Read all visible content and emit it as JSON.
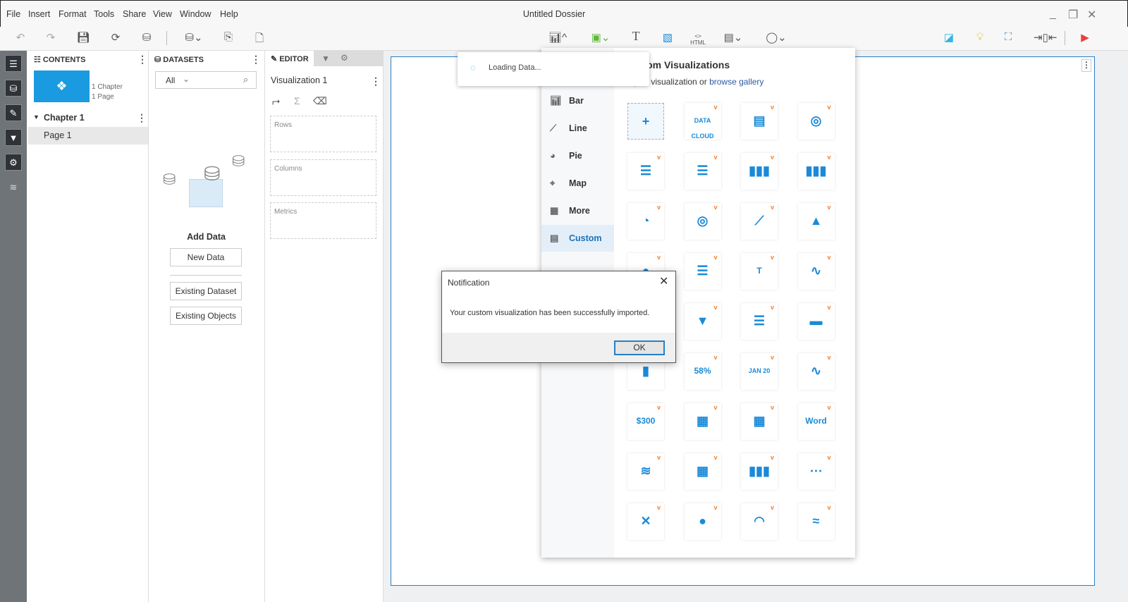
{
  "window": {
    "title": "Untitled Dossier"
  },
  "menu": [
    "File",
    "Insert",
    "Format",
    "Tools",
    "Share",
    "View",
    "Window",
    "Help"
  ],
  "contents": {
    "header": "CONTENTS",
    "summary_chapters": "1 Chapter",
    "summary_pages": "1 Page",
    "chapter": "Chapter 1",
    "page": "Page 1"
  },
  "datasets": {
    "header": "DATASETS",
    "filter": "All",
    "add_data": "Add Data",
    "new_data": "New Data",
    "existing_dataset": "Existing Dataset",
    "existing_objects": "Existing Objects"
  },
  "editor": {
    "tab": "EDITOR",
    "viz_name": "Visualization 1",
    "rows": "Rows",
    "columns": "Columns",
    "metrics": "Metrics"
  },
  "gallery": {
    "title": "Custom Visualizations",
    "subtitle": "Import visualization or",
    "link": "browse gallery",
    "menu": [
      {
        "label": "Bar",
        "icon": "bar-chart-icon"
      },
      {
        "label": "Line",
        "icon": "line-chart-icon"
      },
      {
        "label": "Pie",
        "icon": "pie-chart-icon"
      },
      {
        "label": "Map",
        "icon": "map-icon"
      },
      {
        "label": "More",
        "icon": "more-icon"
      },
      {
        "label": "Custom",
        "icon": "custom-icon",
        "selected": true
      }
    ],
    "tiles": [
      {
        "name": "import",
        "glyph": "+"
      },
      {
        "name": "data-cloud",
        "text": "DATA CLOUD"
      },
      {
        "name": "gantt",
        "glyph": "▤"
      },
      {
        "name": "sunburst",
        "glyph": "◎"
      },
      {
        "name": "bullet-bar",
        "glyph": "☰"
      },
      {
        "name": "stacked-bar",
        "glyph": "☰"
      },
      {
        "name": "column",
        "glyph": "▮▮▮"
      },
      {
        "name": "stacked-column",
        "glyph": "▮▮▮"
      },
      {
        "name": "donut",
        "glyph": "◔"
      },
      {
        "name": "radial",
        "glyph": "◎"
      },
      {
        "name": "stock-line",
        "glyph": "⟋"
      },
      {
        "name": "area",
        "glyph": "▲"
      },
      {
        "name": "bubble",
        "glyph": "●"
      },
      {
        "name": "funnel-bar",
        "glyph": "☰"
      },
      {
        "name": "text-box",
        "text": "T"
      },
      {
        "name": "sparkline",
        "glyph": "∿"
      },
      {
        "name": "waterfall",
        "glyph": "▮"
      },
      {
        "name": "funnel",
        "glyph": "▼"
      },
      {
        "name": "horizontal-gantt",
        "glyph": "☰"
      },
      {
        "name": "bullet",
        "glyph": "▬"
      },
      {
        "name": "vertical-waterfall",
        "glyph": "▮"
      },
      {
        "name": "liquid-gauge",
        "text": "58%"
      },
      {
        "name": "calendar",
        "text": "JAN 20"
      },
      {
        "name": "multi-sparkline",
        "glyph": "∿"
      },
      {
        "name": "kpi",
        "text": "$300"
      },
      {
        "name": "table",
        "glyph": "▦"
      },
      {
        "name": "heatmap",
        "glyph": "▦"
      },
      {
        "name": "word-cloud",
        "text": "Word"
      },
      {
        "name": "microchart",
        "glyph": "≋"
      },
      {
        "name": "grid-heatmap",
        "glyph": "▦"
      },
      {
        "name": "histogram",
        "glyph": "▮▮▮"
      },
      {
        "name": "network",
        "glyph": "⋯"
      },
      {
        "name": "chord",
        "glyph": "✕"
      },
      {
        "name": "packed-bubble",
        "glyph": "●"
      },
      {
        "name": "gauge",
        "glyph": "◠"
      },
      {
        "name": "sankey",
        "glyph": "≈"
      }
    ]
  },
  "toast": {
    "text": "Loading Data..."
  },
  "dialog": {
    "title": "Notification",
    "message": "Your custom visualization has been successfully imported.",
    "ok": "OK"
  },
  "colors": {
    "accent": "#1a8ad8",
    "orange": "#f08030",
    "link": "#2c5aa0"
  }
}
